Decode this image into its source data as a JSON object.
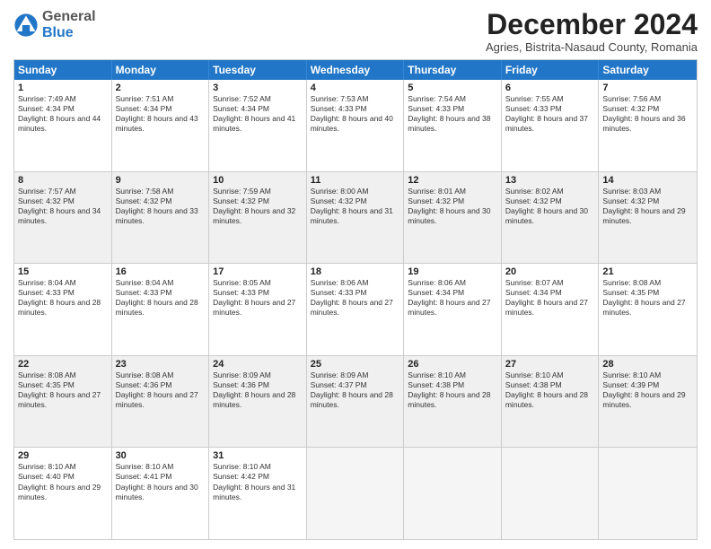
{
  "logo": {
    "general": "General",
    "blue": "Blue"
  },
  "header": {
    "title": "December 2024",
    "subtitle": "Agries, Bistrita-Nasaud County, Romania"
  },
  "days": [
    "Sunday",
    "Monday",
    "Tuesday",
    "Wednesday",
    "Thursday",
    "Friday",
    "Saturday"
  ],
  "weeks": [
    [
      {
        "day": "1",
        "sunrise": "7:49 AM",
        "sunset": "4:34 PM",
        "daylight": "8 hours and 44 minutes."
      },
      {
        "day": "2",
        "sunrise": "7:51 AM",
        "sunset": "4:34 PM",
        "daylight": "8 hours and 43 minutes."
      },
      {
        "day": "3",
        "sunrise": "7:52 AM",
        "sunset": "4:34 PM",
        "daylight": "8 hours and 41 minutes."
      },
      {
        "day": "4",
        "sunrise": "7:53 AM",
        "sunset": "4:33 PM",
        "daylight": "8 hours and 40 minutes."
      },
      {
        "day": "5",
        "sunrise": "7:54 AM",
        "sunset": "4:33 PM",
        "daylight": "8 hours and 38 minutes."
      },
      {
        "day": "6",
        "sunrise": "7:55 AM",
        "sunset": "4:33 PM",
        "daylight": "8 hours and 37 minutes."
      },
      {
        "day": "7",
        "sunrise": "7:56 AM",
        "sunset": "4:32 PM",
        "daylight": "8 hours and 36 minutes."
      }
    ],
    [
      {
        "day": "8",
        "sunrise": "7:57 AM",
        "sunset": "4:32 PM",
        "daylight": "8 hours and 34 minutes."
      },
      {
        "day": "9",
        "sunrise": "7:58 AM",
        "sunset": "4:32 PM",
        "daylight": "8 hours and 33 minutes."
      },
      {
        "day": "10",
        "sunrise": "7:59 AM",
        "sunset": "4:32 PM",
        "daylight": "8 hours and 32 minutes."
      },
      {
        "day": "11",
        "sunrise": "8:00 AM",
        "sunset": "4:32 PM",
        "daylight": "8 hours and 31 minutes."
      },
      {
        "day": "12",
        "sunrise": "8:01 AM",
        "sunset": "4:32 PM",
        "daylight": "8 hours and 30 minutes."
      },
      {
        "day": "13",
        "sunrise": "8:02 AM",
        "sunset": "4:32 PM",
        "daylight": "8 hours and 30 minutes."
      },
      {
        "day": "14",
        "sunrise": "8:03 AM",
        "sunset": "4:32 PM",
        "daylight": "8 hours and 29 minutes."
      }
    ],
    [
      {
        "day": "15",
        "sunrise": "8:04 AM",
        "sunset": "4:33 PM",
        "daylight": "8 hours and 28 minutes."
      },
      {
        "day": "16",
        "sunrise": "8:04 AM",
        "sunset": "4:33 PM",
        "daylight": "8 hours and 28 minutes."
      },
      {
        "day": "17",
        "sunrise": "8:05 AM",
        "sunset": "4:33 PM",
        "daylight": "8 hours and 27 minutes."
      },
      {
        "day": "18",
        "sunrise": "8:06 AM",
        "sunset": "4:33 PM",
        "daylight": "8 hours and 27 minutes."
      },
      {
        "day": "19",
        "sunrise": "8:06 AM",
        "sunset": "4:34 PM",
        "daylight": "8 hours and 27 minutes."
      },
      {
        "day": "20",
        "sunrise": "8:07 AM",
        "sunset": "4:34 PM",
        "daylight": "8 hours and 27 minutes."
      },
      {
        "day": "21",
        "sunrise": "8:08 AM",
        "sunset": "4:35 PM",
        "daylight": "8 hours and 27 minutes."
      }
    ],
    [
      {
        "day": "22",
        "sunrise": "8:08 AM",
        "sunset": "4:35 PM",
        "daylight": "8 hours and 27 minutes."
      },
      {
        "day": "23",
        "sunrise": "8:08 AM",
        "sunset": "4:36 PM",
        "daylight": "8 hours and 27 minutes."
      },
      {
        "day": "24",
        "sunrise": "8:09 AM",
        "sunset": "4:36 PM",
        "daylight": "8 hours and 28 minutes."
      },
      {
        "day": "25",
        "sunrise": "8:09 AM",
        "sunset": "4:37 PM",
        "daylight": "8 hours and 28 minutes."
      },
      {
        "day": "26",
        "sunrise": "8:10 AM",
        "sunset": "4:38 PM",
        "daylight": "8 hours and 28 minutes."
      },
      {
        "day": "27",
        "sunrise": "8:10 AM",
        "sunset": "4:38 PM",
        "daylight": "8 hours and 28 minutes."
      },
      {
        "day": "28",
        "sunrise": "8:10 AM",
        "sunset": "4:39 PM",
        "daylight": "8 hours and 29 minutes."
      }
    ],
    [
      {
        "day": "29",
        "sunrise": "8:10 AM",
        "sunset": "4:40 PM",
        "daylight": "8 hours and 29 minutes."
      },
      {
        "day": "30",
        "sunrise": "8:10 AM",
        "sunset": "4:41 PM",
        "daylight": "8 hours and 30 minutes."
      },
      {
        "day": "31",
        "sunrise": "8:10 AM",
        "sunset": "4:42 PM",
        "daylight": "8 hours and 31 minutes."
      },
      null,
      null,
      null,
      null
    ]
  ]
}
